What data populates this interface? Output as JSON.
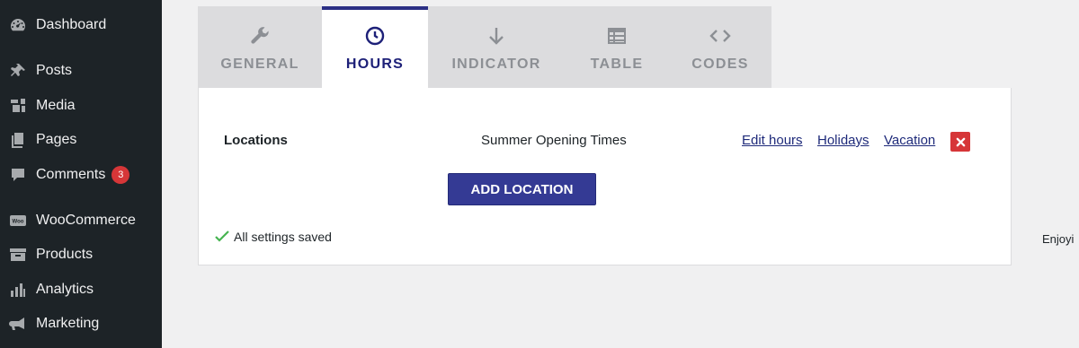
{
  "sidebar": {
    "items": [
      {
        "label": "Dashboard",
        "icon": "dashboard-icon"
      },
      {
        "label": "Posts",
        "icon": "pin-icon"
      },
      {
        "label": "Media",
        "icon": "media-icon"
      },
      {
        "label": "Pages",
        "icon": "pages-icon"
      },
      {
        "label": "Comments",
        "icon": "comment-icon",
        "badge": "3"
      },
      {
        "label": "WooCommerce",
        "icon": "woocommerce-icon"
      },
      {
        "label": "Products",
        "icon": "archive-icon"
      },
      {
        "label": "Analytics",
        "icon": "bar-chart-icon"
      },
      {
        "label": "Marketing",
        "icon": "megaphone-icon"
      }
    ],
    "woo_logo_text": "Woo"
  },
  "tabs": [
    {
      "label": "GENERAL",
      "icon": "wrench-icon",
      "active": false
    },
    {
      "label": "HOURS",
      "icon": "clock-icon",
      "active": true
    },
    {
      "label": "INDICATOR",
      "icon": "arrow-down-icon",
      "active": false
    },
    {
      "label": "TABLE",
      "icon": "table-icon",
      "active": false
    },
    {
      "label": "CODES",
      "icon": "code-icon",
      "active": false
    }
  ],
  "locations": {
    "label": "Locations",
    "name": "Summer Opening Times",
    "edit_hours": "Edit hours",
    "holidays": "Holidays",
    "vacation": "Vacation",
    "add_button": "ADD LOCATION"
  },
  "status": {
    "saved": "All settings saved"
  },
  "side_note": "Enjoyi",
  "colors": {
    "sidebar_bg": "#1d2327",
    "accent": "#2b2f85",
    "danger": "#d63638",
    "success": "#46b450"
  }
}
